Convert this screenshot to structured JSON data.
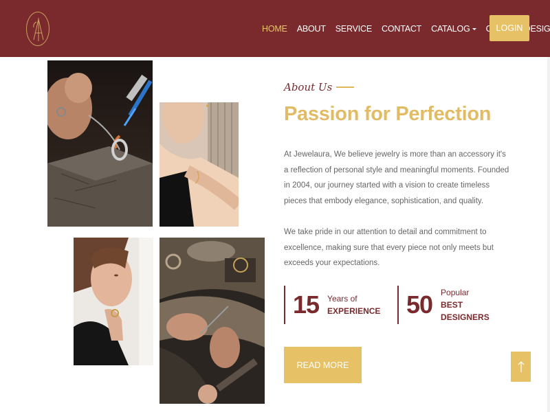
{
  "brand": {
    "logo_text": "LA"
  },
  "nav": {
    "items": [
      {
        "label": "HOME",
        "active": true
      },
      {
        "label": "ABOUT"
      },
      {
        "label": "SERVICE"
      },
      {
        "label": "CONTACT"
      },
      {
        "label": "CATALOG",
        "dropdown": true
      },
      {
        "label": "CUSTOM DESIGN"
      }
    ],
    "login_label": "LOGIN"
  },
  "about": {
    "eyebrow": "About Us",
    "heading": "Passion for Perfection",
    "paragraph1": "At Jewelaura, We believe jewelry is more than an accessory it's a reflection of personal style and meaningful moments. Founded in 2004, our journey started with a vision to create timeless pieces that embody elegance, sophistication, and quality.",
    "paragraph2": "We take pride in our attention to detail and commitment to excellence, making sure that every piece not only meets but exceeds your expectations.",
    "stats": [
      {
        "number": "15",
        "line1": "Years of",
        "line2": "EXPERIENCE"
      },
      {
        "number": "50",
        "line1": "Popular",
        "line2": "BEST",
        "line3": "DESIGNERS"
      }
    ],
    "read_more_label": "READ MORE"
  },
  "images": [
    {
      "name": "jeweler-soldering-ring-photo"
    },
    {
      "name": "woman-wearing-bracelet-photo"
    },
    {
      "name": "woman-wearing-ring-photo"
    },
    {
      "name": "jeweler-workbench-photo"
    }
  ],
  "icons": {
    "scroll_top": "arrow-up-icon",
    "catalog_caret": "caret-down-icon"
  },
  "colors": {
    "primary": "#7a2a2d",
    "accent": "#e6c166",
    "heading": "#e2bc64",
    "text": "#666666"
  }
}
